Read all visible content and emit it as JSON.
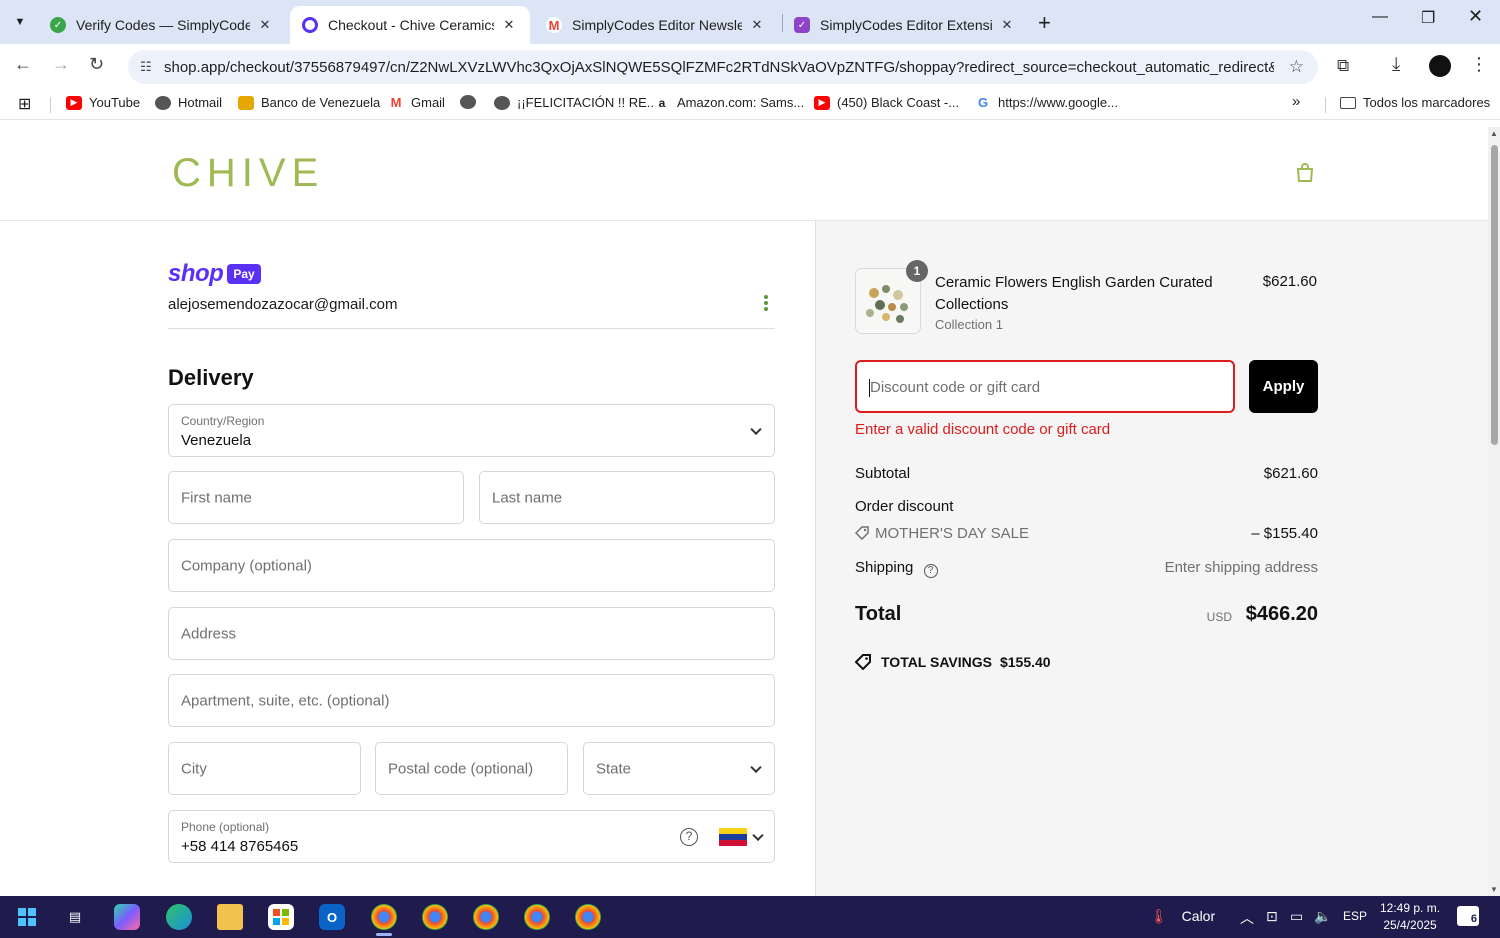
{
  "browser": {
    "tabs": [
      {
        "title": "Verify Codes — SimplyCodes",
        "active": false
      },
      {
        "title": "Checkout - Chive Ceramics Stuc",
        "active": true
      },
      {
        "title": "SimplyCodes Editor Newsletter",
        "active": false
      },
      {
        "title": "SimplyCodes Editor Extension: E",
        "active": false
      }
    ],
    "url": "shop.app/checkout/37556879497/cn/Z2NwLXVzLWVhc3QxOjAxSlNQWE5SQlFZMFc2RTdNSkVaOVpZNTFG/shoppay?redirect_source=checkout_automatic_redirect&trackin...",
    "bookmarks": [
      {
        "label": "YouTube",
        "icon": "youtube-icon",
        "color": "#ff0000"
      },
      {
        "label": "Hotmail",
        "icon": "globe-icon",
        "color": "#555555"
      },
      {
        "label": "Banco de Venezuela",
        "icon": "bank-icon",
        "color": "#e6a800"
      },
      {
        "label": "Gmail",
        "icon": "gmail-icon",
        "color": "#ea4335"
      },
      {
        "label": "",
        "icon": "globe-icon",
        "color": "#555555"
      },
      {
        "label": "¡¡FELICITACIÓN !! RE...",
        "icon": "globe-icon",
        "color": "#555555"
      },
      {
        "label": "Amazon.com: Sams...",
        "icon": "amazon-icon",
        "color": "#222222"
      },
      {
        "label": "(450) Black Coast -...",
        "icon": "youtube-icon",
        "color": "#ff0000"
      },
      {
        "label": "https://www.google...",
        "icon": "google-icon",
        "color": "#4285f4"
      }
    ],
    "all_bookmarks": "Todos los marcadores"
  },
  "store": {
    "logo": "CHIVE",
    "brand_color": "#9fb955"
  },
  "contact": {
    "shop_word": "shop",
    "pay_badge": "Pay",
    "email": "alejosemendozazocar@gmail.com"
  },
  "delivery": {
    "heading": "Delivery",
    "country_label": "Country/Region",
    "country_value": "Venezuela",
    "first_name_placeholder": "First name",
    "last_name_placeholder": "Last name",
    "company_placeholder": "Company (optional)",
    "address_placeholder": "Address",
    "apartment_placeholder": "Apartment, suite, etc. (optional)",
    "city_placeholder": "City",
    "postal_placeholder": "Postal code (optional)",
    "state_placeholder": "State",
    "phone_label": "Phone (optional)",
    "phone_value": "+58 414 8765465",
    "help_glyph": "?"
  },
  "summary": {
    "product": {
      "quantity": "1",
      "name": "Ceramic Flowers English Garden Curated Collections",
      "variant": "Collection 1",
      "price": "$621.60"
    },
    "discount_placeholder": "Discount code or gift card",
    "apply_label": "Apply",
    "error": "Enter a valid discount code or gift card",
    "subtotal_label": "Subtotal",
    "subtotal_value": "$621.60",
    "order_discount_label": "Order discount",
    "discount_code": "MOTHER'S DAY SALE",
    "discount_value": "– $155.40",
    "shipping_label": "Shipping",
    "shipping_value": "Enter shipping address",
    "total_label": "Total",
    "currency": "USD",
    "total_value": "$466.20",
    "savings_label": "TOTAL SAVINGS",
    "savings_value": "$155.40",
    "error_color": "#dd1d1d"
  },
  "taskbar": {
    "weather": "Calor",
    "language": "ESP",
    "time": "12:49 p. m.",
    "date": "25/4/2025",
    "notifications": "6"
  }
}
